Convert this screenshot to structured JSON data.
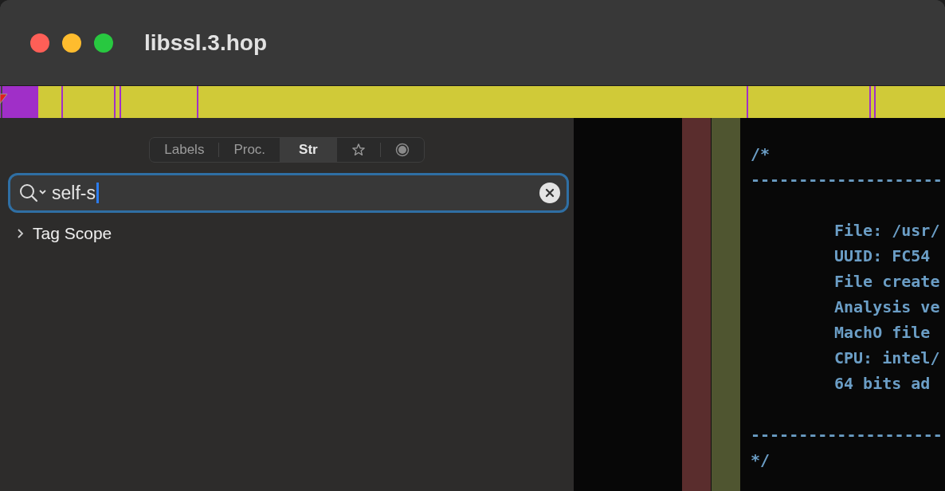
{
  "window": {
    "title": "libssl.3.hop"
  },
  "tabs": [
    {
      "label": "Labels",
      "kind": "text",
      "selected": false
    },
    {
      "label": "Proc.",
      "kind": "text",
      "selected": false
    },
    {
      "label": "Str",
      "kind": "text",
      "selected": true
    },
    {
      "kind": "star",
      "selected": false
    },
    {
      "kind": "dot",
      "selected": false
    }
  ],
  "search": {
    "value": "self-s"
  },
  "sidebar": {
    "items": [
      {
        "label": "Tag Scope",
        "expanded": false
      }
    ]
  },
  "code": {
    "lines": [
      {
        "kind": "blank"
      },
      {
        "kind": "plain",
        "text": "/*"
      },
      {
        "kind": "plain",
        "text": "--------------------"
      },
      {
        "kind": "blank"
      },
      {
        "kind": "indented",
        "text": "File: /usr/"
      },
      {
        "kind": "indented",
        "text": "UUID: FC54"
      },
      {
        "kind": "indented",
        "text": "File create"
      },
      {
        "kind": "indented",
        "text": "Analysis ve"
      },
      {
        "kind": "indented",
        "text": "MachO file"
      },
      {
        "kind": "indented",
        "text": "CPU: intel/"
      },
      {
        "kind": "indented",
        "text": "64 bits ad"
      },
      {
        "kind": "blank"
      },
      {
        "kind": "plain",
        "text": "--------------------"
      },
      {
        "kind": "plain",
        "text": "*/"
      }
    ]
  }
}
